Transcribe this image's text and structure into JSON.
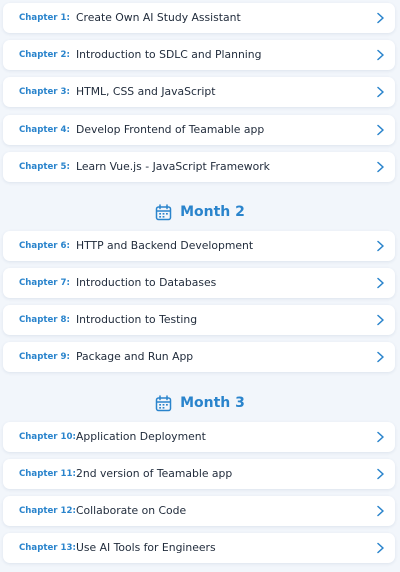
{
  "months": [
    {
      "title": "Month 2"
    },
    {
      "title": "Month 3"
    }
  ],
  "chapters": [
    {
      "label": "Chapter 1:",
      "title": "Create Own AI Study Assistant"
    },
    {
      "label": "Chapter 2:",
      "title": "Introduction to SDLC and Planning"
    },
    {
      "label": "Chapter 3:",
      "title": "HTML, CSS and JavaScript"
    },
    {
      "label": "Chapter 4:",
      "title": "Develop Frontend of Teamable app"
    },
    {
      "label": "Chapter 5:",
      "title": "Learn Vue.js - JavaScript Framework"
    },
    {
      "label": "Chapter 6:",
      "title": "HTTP and Backend Development"
    },
    {
      "label": "Chapter 7:",
      "title": "Introduction to Databases"
    },
    {
      "label": "Chapter 8:",
      "title": "Introduction to Testing"
    },
    {
      "label": "Chapter 9:",
      "title": "Package and Run App"
    },
    {
      "label": "Chapter 10:",
      "title": "Application Deployment"
    },
    {
      "label": "Chapter 11:",
      "title": "2nd version of Teamable app"
    },
    {
      "label": "Chapter 12:",
      "title": "Collaborate on Code"
    },
    {
      "label": "Chapter 13:",
      "title": "Use AI Tools for Engineers"
    }
  ],
  "colors": {
    "accent": "#2a84cc",
    "text": "#1f2a3a",
    "background": "#f2f6fb",
    "card": "#ffffff"
  },
  "icons": {
    "chevron": "chevron-right-icon",
    "month": "calendar-icon"
  }
}
